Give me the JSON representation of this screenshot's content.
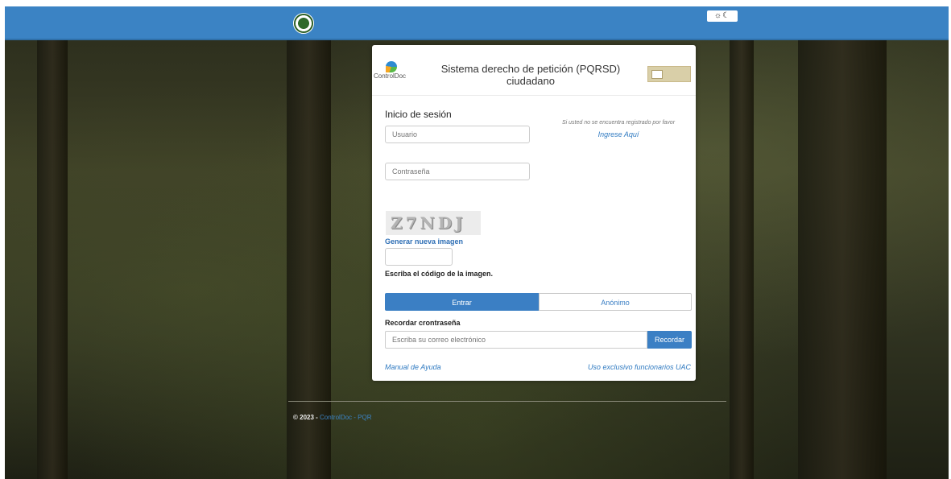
{
  "topbar": {
    "theme_toggle": "☼☾"
  },
  "header": {
    "brand_logo_text": "ControlDoc",
    "title_line1": "Sistema derecho de petición (PQRSD)",
    "title_line2": "ciudadano"
  },
  "login": {
    "title": "Inicio de sesión",
    "username_placeholder": "Usuario",
    "password_placeholder": "Contraseña",
    "register_note": "Si usted no se encuentra registrado por favor",
    "register_link": "Ingrese Aquí"
  },
  "captcha": {
    "code": "Z7NDJ",
    "regenerate_link": "Generar nueva imagen",
    "hint": "Escriba el código de la imagen."
  },
  "actions": {
    "enter_label": "Entrar",
    "anonymous_label": "Anónimo"
  },
  "recover": {
    "title": "Recordar crontraseña",
    "email_placeholder": "Escriba su correo electrónico",
    "button_label": "Recordar"
  },
  "links": {
    "manual": "Manual de Ayuda",
    "uac": "Uso exclusivo funcionarios UAC"
  },
  "footer": {
    "copyright": "© 2023 - ",
    "link": "ControlDoc - PQR"
  },
  "colors": {
    "primary": "#3b83c4",
    "link": "#2f7ac1"
  }
}
